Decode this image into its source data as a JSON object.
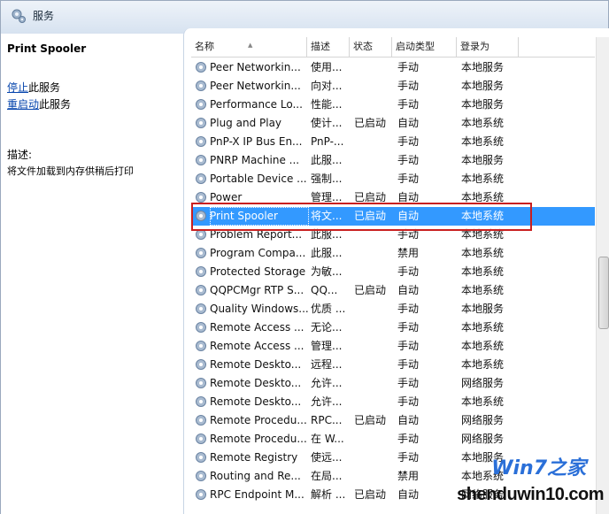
{
  "window": {
    "title": "服务"
  },
  "left_panel": {
    "service_name": "Print Spooler",
    "stop_link": "停止",
    "stop_suffix": "此服务",
    "restart_link": "重启动",
    "restart_suffix": "此服务",
    "desc_label": "描述:",
    "desc_text": "将文件加载到内存供稍后打印"
  },
  "columns": [
    "名称",
    "描述",
    "状态",
    "启动类型",
    "登录为"
  ],
  "rows": [
    [
      "Peer Networkin...",
      "使用...",
      "",
      "手动",
      "本地服务"
    ],
    [
      "Peer Networkin...",
      "向对...",
      "",
      "手动",
      "本地服务"
    ],
    [
      "Performance Lo...",
      "性能...",
      "",
      "手动",
      "本地服务"
    ],
    [
      "Plug and Play",
      "使计...",
      "已启动",
      "自动",
      "本地系统"
    ],
    [
      "PnP-X IP Bus En...",
      "PnP-...",
      "",
      "手动",
      "本地系统"
    ],
    [
      "PNRP Machine ...",
      "此服...",
      "",
      "手动",
      "本地服务"
    ],
    [
      "Portable Device ...",
      "强制...",
      "",
      "手动",
      "本地系统"
    ],
    [
      "Power",
      "管理...",
      "已启动",
      "自动",
      "本地系统"
    ],
    [
      "Print Spooler",
      "将文...",
      "已启动",
      "自动",
      "本地系统"
    ],
    [
      "Problem Report...",
      "此服...",
      "",
      "手动",
      "本地系统"
    ],
    [
      "Program Compa...",
      "此服...",
      "",
      "禁用",
      "本地系统"
    ],
    [
      "Protected Storage",
      "为敏...",
      "",
      "手动",
      "本地系统"
    ],
    [
      "QQPCMgr RTP S...",
      "QQ...",
      "已启动",
      "自动",
      "本地系统"
    ],
    [
      "Quality Windows...",
      "优质 ...",
      "",
      "手动",
      "本地服务"
    ],
    [
      "Remote Access ...",
      "无论...",
      "",
      "手动",
      "本地系统"
    ],
    [
      "Remote Access ...",
      "管理...",
      "",
      "手动",
      "本地系统"
    ],
    [
      "Remote Deskto...",
      "远程...",
      "",
      "手动",
      "本地系统"
    ],
    [
      "Remote Deskto...",
      "允许...",
      "",
      "手动",
      "网络服务"
    ],
    [
      "Remote Deskto...",
      "允许...",
      "",
      "手动",
      "本地系统"
    ],
    [
      "Remote Procedu...",
      "RPC...",
      "已启动",
      "自动",
      "网络服务"
    ],
    [
      "Remote Procedu...",
      "在 W...",
      "",
      "手动",
      "网络服务"
    ],
    [
      "Remote Registry",
      "使远...",
      "",
      "手动",
      "本地服务"
    ],
    [
      "Routing and Re...",
      "在局...",
      "",
      "禁用",
      "本地系统"
    ],
    [
      "RPC Endpoint M...",
      "解析 ...",
      "已启动",
      "自动",
      "网络服务"
    ]
  ],
  "selected_index": 8,
  "watermark": {
    "brand": "Win7之家",
    "site": "shenduwin10.com"
  },
  "colors": {
    "selection": "#3399ff",
    "highlight_box": "#c91f1f"
  }
}
